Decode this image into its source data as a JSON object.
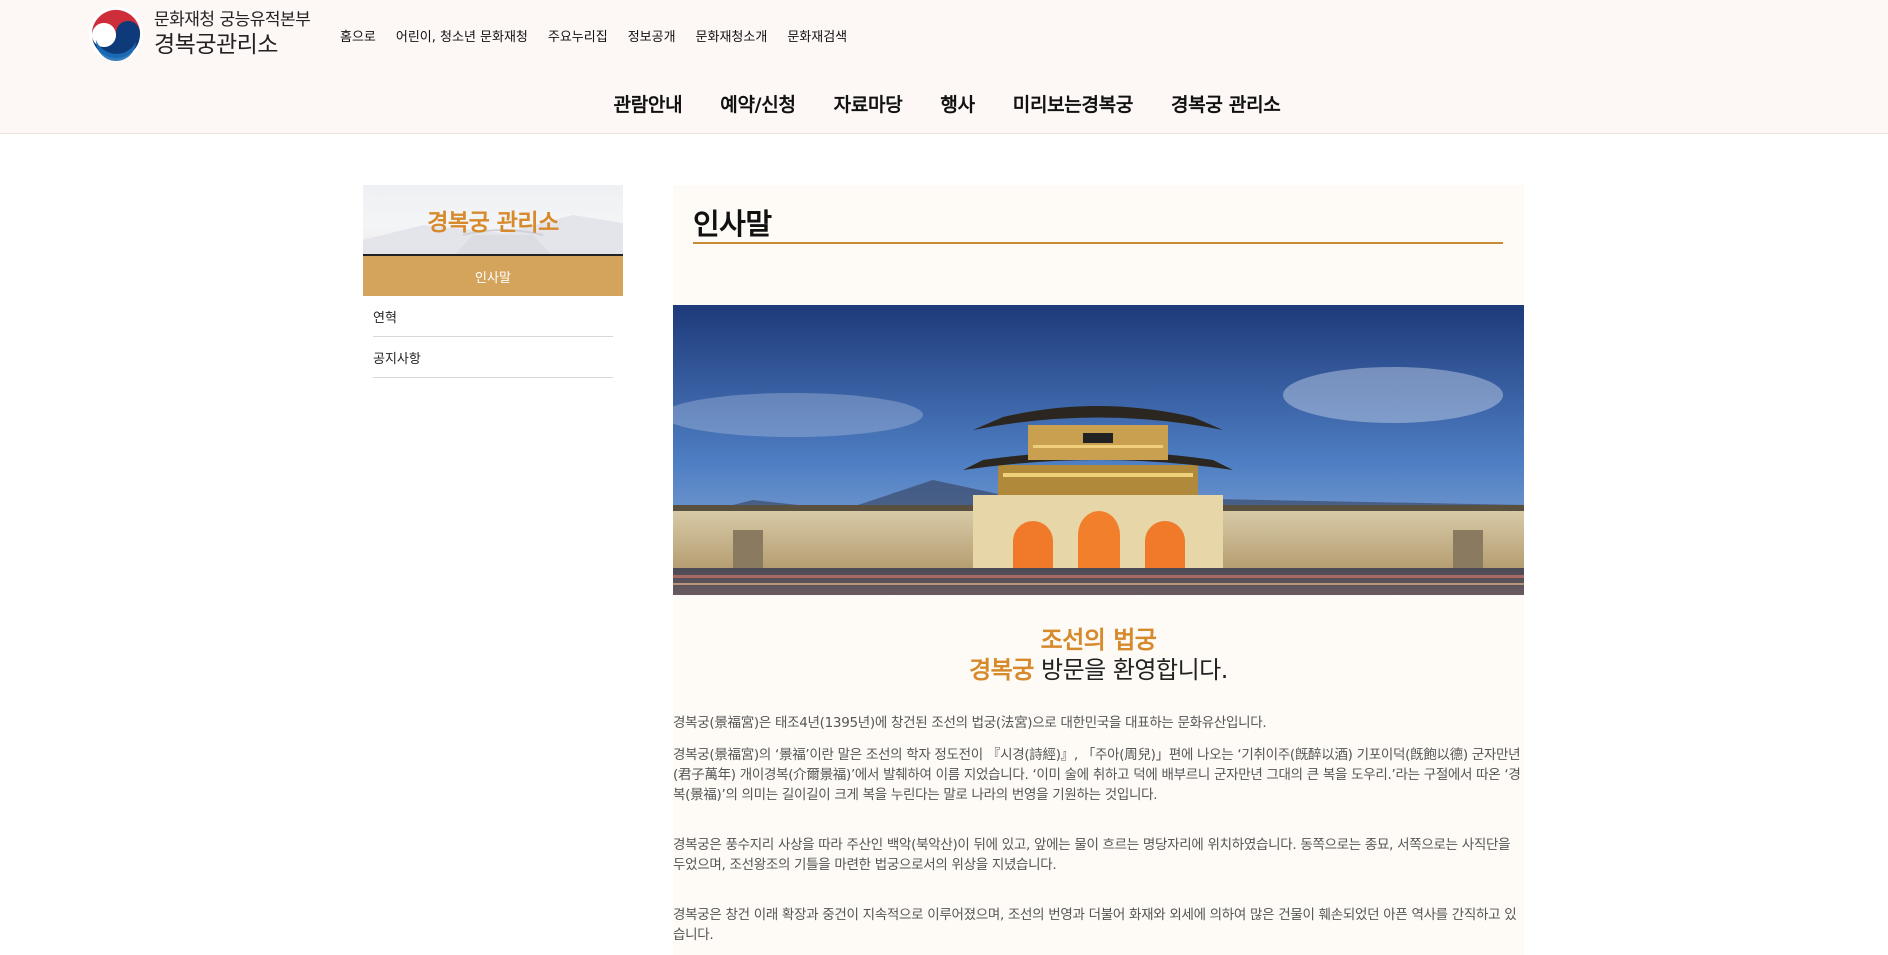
{
  "header": {
    "logo_line1": "문화재청 궁능유적본부",
    "logo_line2": "경복궁관리소",
    "util_nav": [
      "홈으로",
      "어린이, 청소년 문화재청",
      "주요누리집",
      "정보공개",
      "문화재청소개",
      "문화재검색"
    ],
    "gnb": [
      "관람안내",
      "예약/신청",
      "자료마당",
      "행사",
      "미리보는경복궁",
      "경복궁 관리소"
    ]
  },
  "sidebar": {
    "title": "경복궁 관리소",
    "active_item": "인사말",
    "items": [
      "연혁",
      "공지사항"
    ]
  },
  "content": {
    "page_title": "인사말",
    "welcome_accent1": "조선의 법궁",
    "welcome_accent2": "경복궁",
    "welcome_rest": "방문을 환영합니다.",
    "paragraphs": [
      "경복궁(景福宮)은 태조4년(1395년)에 창건된 조선의 법궁(法宮)으로 대한민국을 대표하는 문화유산입니다.",
      "경복궁(景福宮)의 ‘景福’이란 말은 조선의 학자 정도전이 『시경(詩經)』, 「주아(周兒)」편에 나오는 ‘기취이주(旣醉以酒) 기포이덕(旣飽以德) 군자만년(君子萬年) 개이경복(介爾景福)’에서 발췌하여 이름 지었습니다. ‘이미 술에 취하고 덕에 배부르니 군자만년 그대의 큰 복을 도우리.’라는 구절에서 따온 ‘경복(景福)’의 의미는 길이길이 크게 복을 누린다는 말로 나라의 번영을 기원하는 것입니다.",
      "경복궁은 풍수지리 사상을 따라 주산인 백악(북악산)이 뒤에 있고, 앞에는 물이 흐르는 명당자리에 위치하였습니다. 동쪽으로는 종묘, 서쪽으로는 사직단을 두었으며, 조선왕조의 기틀을 마련한 법궁으로서의 위상을 지녔습니다.",
      "경복궁은 창건 이래 확장과 중건이 지속적으로 이루어졌으며, 조선의 번영과 더불어 화재와 외세에 의하여 많은 건물이 훼손되었던 아픈 역사를 간직하고 있습니다."
    ]
  },
  "colors": {
    "accent": "#d68a2c",
    "sidebar_active_bg": "#d4a45c",
    "title_rule": "#c98a34",
    "header_bg": "#fdf8f6",
    "content_bg": "#fefbf7"
  }
}
